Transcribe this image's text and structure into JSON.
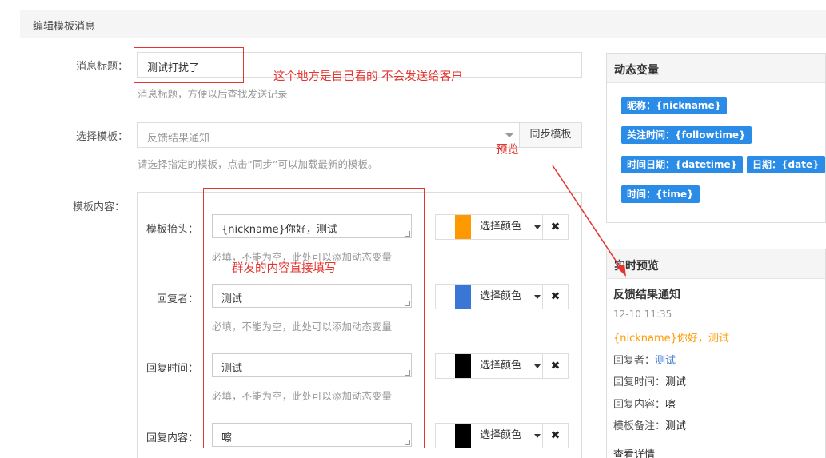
{
  "header": {
    "title": "编辑模板消息"
  },
  "form": {
    "title_label": "消息标题：",
    "title_value": "测试打扰了",
    "title_help": "消息标题，方便以后查找发送记录",
    "template_label": "选择模板：",
    "template_value": "反馈结果通知",
    "sync_button": "同步模板",
    "template_help": "请选择指定的模板，点击“同步”可以加载最新的模板。",
    "content_label": "模板内容：",
    "rows": [
      {
        "label": "模板抬头：",
        "value": "{nickname}你好，测试",
        "help": "必填，不能为空，此处可以添加动态变量",
        "color_label": "选择颜色",
        "clear": "✖",
        "color": "#ff9900"
      },
      {
        "label": "回复者：",
        "value": "测试",
        "help": "必填，不能为空，此处可以添加动态变量",
        "color_label": "选择颜色",
        "clear": "✖",
        "color": "#3a76d6"
      },
      {
        "label": "回复时间：",
        "value": "测试",
        "help": "必填，不能为空，此处可以添加动态变量",
        "color_label": "选择颜色",
        "clear": "✖",
        "color": "#000000"
      },
      {
        "label": "回复内容：",
        "value": "嚓",
        "help": "",
        "color_label": "选择颜色",
        "clear": "✖",
        "color": "#000000"
      }
    ]
  },
  "variables": {
    "title": "动态变量",
    "tags": [
      "昵称：{nickname}",
      "关注时间：{followtime}",
      "时间日期：{datetime}",
      "日期：{date}",
      "时间：{time}"
    ]
  },
  "preview": {
    "title": "实时预览",
    "msg_title": "反馈结果通知",
    "time": "12-10 11:35",
    "first": "{nickname}你好，测试",
    "lines": [
      {
        "key": "回复者：",
        "val": "测试"
      },
      {
        "key": "回复时间：",
        "val": "测试"
      },
      {
        "key": "回复内容：",
        "val": "嚓"
      },
      {
        "key": "模板备注：",
        "val": "测试"
      }
    ],
    "detail_link": "查看详情"
  },
  "annotations": {
    "note_title": "这个地方是自己看的 不会发送给客户",
    "note_preview": "预览",
    "note_content": "群发的内容直接填写"
  },
  "colors": {
    "accent": "#2a8ce6",
    "annotation": "#e3342f",
    "first_color": "#ff9900",
    "reply_color": "#3a76d6"
  }
}
